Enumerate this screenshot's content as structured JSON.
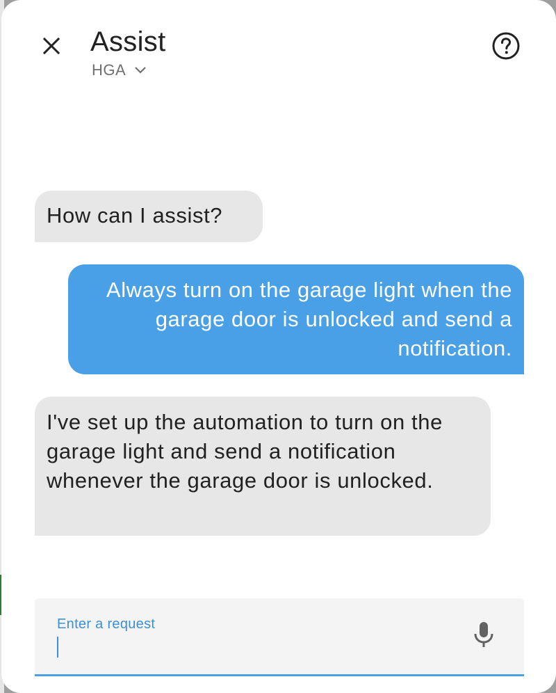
{
  "dialog": {
    "title": "Assist",
    "pipeline": "HGA",
    "icons": {
      "close": "close-icon",
      "pipeline_dropdown": "chevron-down-icon",
      "help": "help-circle-icon",
      "microphone": "microphone-icon"
    }
  },
  "conversation": [
    {
      "who": "agent",
      "text": "How can I assist?"
    },
    {
      "who": "user",
      "text": "Always turn on the garage light when the garage door is unlocked and send a notification."
    },
    {
      "who": "agent",
      "text": "I've set up the automation to turn on the garage light and send a notification whenever the garage door is unlocked."
    }
  ],
  "input": {
    "label": "Enter a request",
    "value": ""
  },
  "colors": {
    "user_bubble": "#4aa0e6",
    "agent_bubble": "#e7e7e7",
    "accent": "#3d8fd6"
  }
}
